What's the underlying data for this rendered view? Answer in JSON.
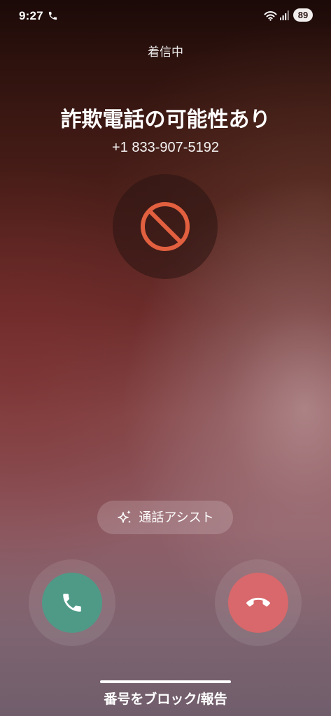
{
  "status_bar": {
    "time": "9:27",
    "battery_level": "89"
  },
  "call": {
    "state": "着信中",
    "warning_title": "詐欺電話の可能性あり",
    "phone_number": "+1 833-907-5192"
  },
  "assist_button": {
    "label": "通話アシスト"
  },
  "footer": {
    "block_report_label": "番号をブロック/報告"
  },
  "icons": {
    "status_call": "phone-icon",
    "wifi": "wifi-icon",
    "signal": "signal-icon",
    "caller_avatar": "prohibited-icon",
    "assist": "sparkle-icon",
    "accept": "phone-icon",
    "decline": "call-end-icon"
  },
  "colors": {
    "accept": "#4f9a87",
    "decline": "#d8686b",
    "prohibited": "#e2603f"
  }
}
